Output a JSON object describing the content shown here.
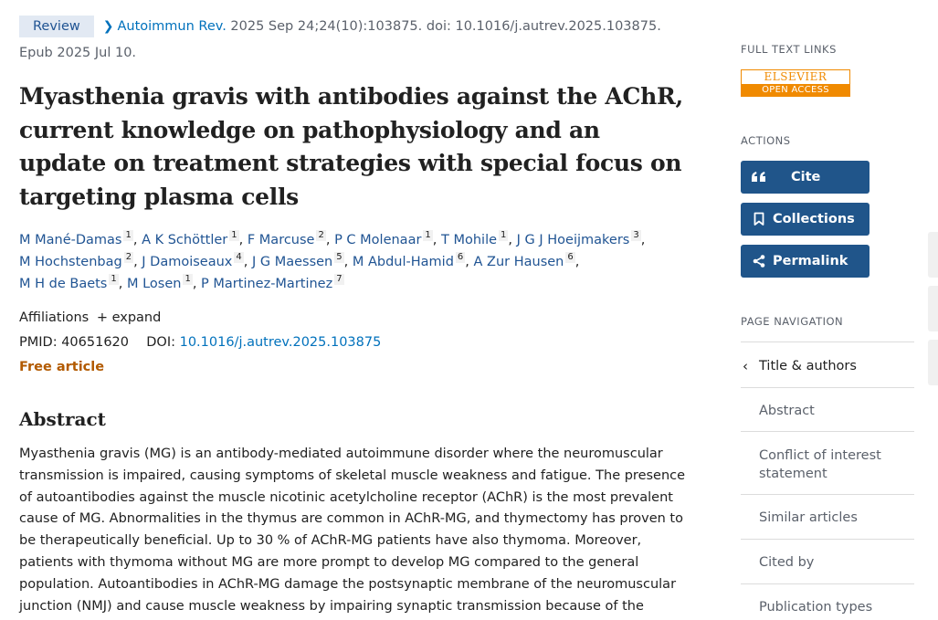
{
  "header": {
    "badge": "Review",
    "journal": "Autoimmun Rev.",
    "citation": " 2025 Sep 24;24(10):103875. doi: 10.1016/j.autrev.2025.103875.",
    "epub": "Epub 2025 Jul 10."
  },
  "article": {
    "title": "Myasthenia gravis with antibodies against the AChR, current knowledge on pathophysiology and an update on treatment strategies with special focus on targeting plasma cells",
    "authors": [
      {
        "name": "M Mané-Damas",
        "aff": "1"
      },
      {
        "name": "A K Schöttler",
        "aff": "1"
      },
      {
        "name": "F Marcuse",
        "aff": "2"
      },
      {
        "name": "P C Molenaar",
        "aff": "1"
      },
      {
        "name": "T Mohile",
        "aff": "1"
      },
      {
        "name": "J G J Hoeijmakers",
        "aff": "3"
      },
      {
        "name": "M Hochstenbag",
        "aff": "2"
      },
      {
        "name": "J Damoiseaux",
        "aff": "4"
      },
      {
        "name": "J G Maessen",
        "aff": "5"
      },
      {
        "name": "M Abdul-Hamid",
        "aff": "6"
      },
      {
        "name": "A Zur Hausen",
        "aff": "6"
      },
      {
        "name": "M H de Baets",
        "aff": "1"
      },
      {
        "name": "M Losen",
        "aff": "1"
      },
      {
        "name": "P Martinez-Martinez",
        "aff": "7"
      }
    ],
    "affiliations_label": "Affiliations",
    "expand_label": "expand",
    "pmid_label": "PMID: ",
    "pmid": "40651620",
    "doi_label": "DOI: ",
    "doi": "10.1016/j.autrev.2025.103875",
    "free_label": "Free article",
    "abstract_heading": "Abstract",
    "abstract_text": "Myasthenia gravis (MG) is an antibody-mediated autoimmune disorder where the neuromuscular transmission is impaired, causing symptoms of skeletal muscle weakness and fatigue. The presence of autoantibodies against the muscle nicotinic acetylcholine receptor (AChR) is the most prevalent cause of MG. Abnormalities in the thymus are common in AChR-MG, and thymectomy has proven to be therapeutically beneficial. Up to 30 % of AChR-MG patients have also thymoma. Moreover, patients with thymoma without MG are more prompt to develop MG compared to the general population. Autoantibodies in AChR-MG damage the postsynaptic membrane of the neuromuscular junction (NMJ) and cause muscle weakness by impairing synaptic transmission because of the depletion of the"
  },
  "sidebar": {
    "full_text_heading": "FULL TEXT LINKS",
    "elsevier_top": "ELSEVIER",
    "elsevier_bottom": "OPEN ACCESS",
    "actions_heading": "ACTIONS",
    "cite_label": "Cite",
    "collections_label": "Collections",
    "permalink_label": "Permalink",
    "page_nav_heading": "PAGE NAVIGATION",
    "nav_items": [
      "Title & authors",
      "Abstract",
      "Conflict of interest statement",
      "Similar articles",
      "Cited by",
      "Publication types"
    ]
  },
  "colors": {
    "link": "#0071bc",
    "author": "#205493",
    "button": "#20558a",
    "free": "#b25a00",
    "elsevier": "#f08a00"
  }
}
